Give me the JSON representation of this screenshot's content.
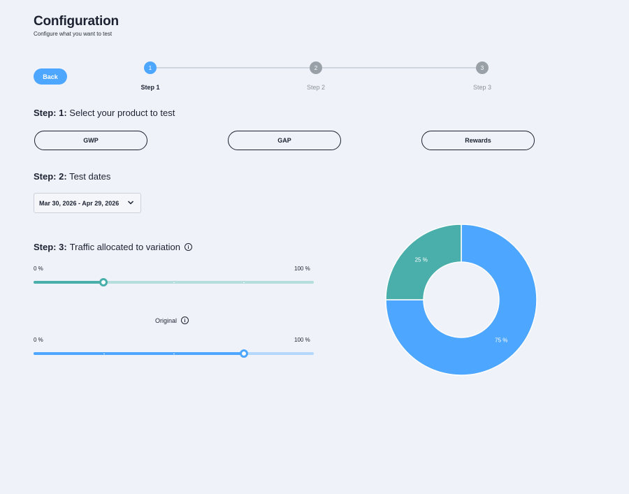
{
  "header": {
    "title": "Configuration",
    "subtitle": "Configure what you want to test"
  },
  "back_label": "Back",
  "stepper": {
    "steps": [
      {
        "number": "1",
        "label": "Step 1",
        "state": "active"
      },
      {
        "number": "2",
        "label": "Step 2",
        "state": "inactive"
      },
      {
        "number": "3",
        "label": "Step 3",
        "state": "inactive"
      }
    ]
  },
  "step1": {
    "prefix": "Step: 1:",
    "title": "Select your product to test",
    "products": [
      "GWP",
      "GAP",
      "Rewards"
    ]
  },
  "step2": {
    "prefix": "Step: 2:",
    "title": "Test dates",
    "date_range": "Mar 30, 2026 - Apr 29, 2026"
  },
  "step3": {
    "prefix": "Step: 3:",
    "title": "Traffic allocated to variation",
    "variation_slider": {
      "min_label": "0 %",
      "max_label": "100 %",
      "value_percent": 25
    },
    "original_label": "Original",
    "original_slider": {
      "min_label": "0 %",
      "max_label": "100 %",
      "value_percent": 75
    }
  },
  "colors": {
    "accent_blue": "#4da6ff",
    "variation_teal": "#4aafaa",
    "background": "#eff3f9",
    "inactive_gray": "#9aa0a8"
  },
  "icons": {
    "info": "info-icon",
    "chevron": "chevron-down-icon"
  },
  "chart_data": {
    "type": "pie",
    "variant": "donut",
    "slices": [
      {
        "label": "25 %",
        "value": 25,
        "color": "#4aafaa"
      },
      {
        "label": "75 %",
        "value": 75,
        "color": "#4da6ff"
      }
    ]
  }
}
